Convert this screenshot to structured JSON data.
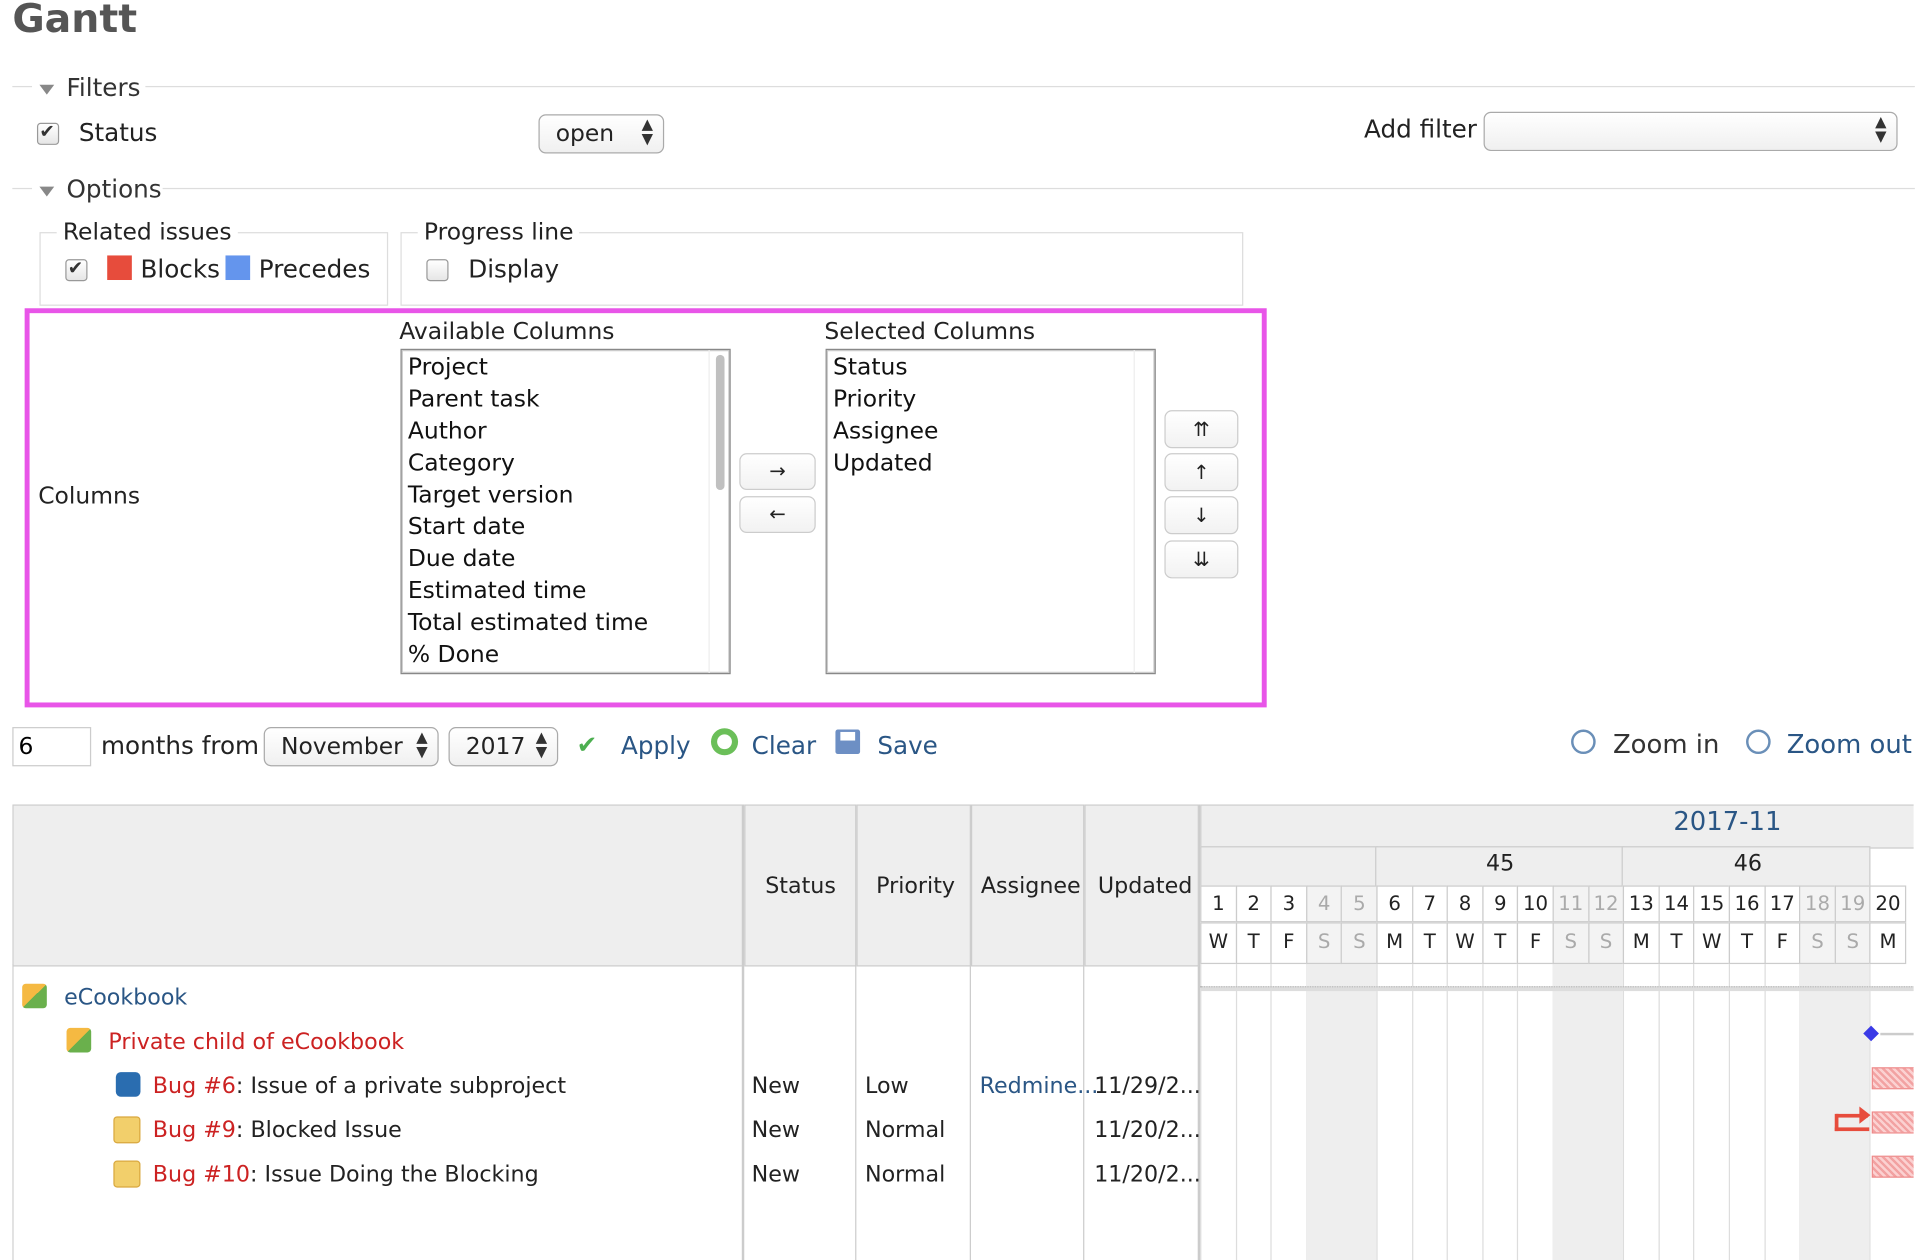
{
  "title": "Gantt",
  "filters": {
    "legend": "Filters",
    "status_label": "Status",
    "status_value": "open",
    "add_filter_label": "Add filter",
    "add_filter_value": ""
  },
  "options": {
    "legend": "Options",
    "related_issues": {
      "legend": "Related issues",
      "blocks": "Blocks",
      "precedes": "Precedes"
    },
    "progress_line": {
      "legend": "Progress line",
      "display": "Display"
    },
    "columns_label": "Columns",
    "available_title": "Available Columns",
    "available": [
      "Project",
      "Parent task",
      "Author",
      "Category",
      "Target version",
      "Start date",
      "Due date",
      "Estimated time",
      "Total estimated time",
      "% Done"
    ],
    "selected_title": "Selected Columns",
    "selected": [
      "Status",
      "Priority",
      "Assignee",
      "Updated"
    ],
    "move_right": "→",
    "move_left": "←",
    "top": "⇈",
    "up": "↑",
    "down": "↓",
    "bottom": "⇊"
  },
  "toolbar": {
    "months_value": "6",
    "months_from": "months from",
    "month": "November",
    "year": "2017",
    "apply": "Apply",
    "clear": "Clear",
    "save": "Save",
    "zoom_in": "Zoom in",
    "zoom_out": "Zoom out"
  },
  "colors": {
    "blocks": "#e74c3c",
    "precedes": "#6495ed",
    "highlight": "#e855e8",
    "link": "#2a5685"
  },
  "table": {
    "headers": [
      "Status",
      "Priority",
      "Assignee",
      "Updated"
    ],
    "month_label": "2017-11",
    "weeks": [
      "45",
      "46"
    ],
    "days": [
      "1",
      "2",
      "3",
      "4",
      "5",
      "6",
      "7",
      "8",
      "9",
      "10",
      "11",
      "12",
      "13",
      "14",
      "15",
      "16",
      "17",
      "18",
      "19",
      "20"
    ],
    "weekdays": [
      "W",
      "T",
      "F",
      "S",
      "S",
      "M",
      "T",
      "W",
      "T",
      "F",
      "S",
      "S",
      "M",
      "T",
      "W",
      "T",
      "F",
      "S",
      "S",
      "M"
    ],
    "project": "eCookbook",
    "subproject": "Private child of eCookbook",
    "issues": [
      {
        "tracker": "Bug #6",
        "subject": "Issue of a private subproject",
        "status": "New",
        "priority": "Low",
        "assignee": "Redmine...",
        "updated": "11/29/2..."
      },
      {
        "tracker": "Bug #9",
        "subject": "Blocked Issue",
        "status": "New",
        "priority": "Normal",
        "assignee": "",
        "updated": "11/20/2..."
      },
      {
        "tracker": "Bug #10",
        "subject": "Issue Doing the Blocking",
        "status": "New",
        "priority": "Normal",
        "assignee": "",
        "updated": "11/20/2..."
      }
    ],
    "sep": ": "
  }
}
